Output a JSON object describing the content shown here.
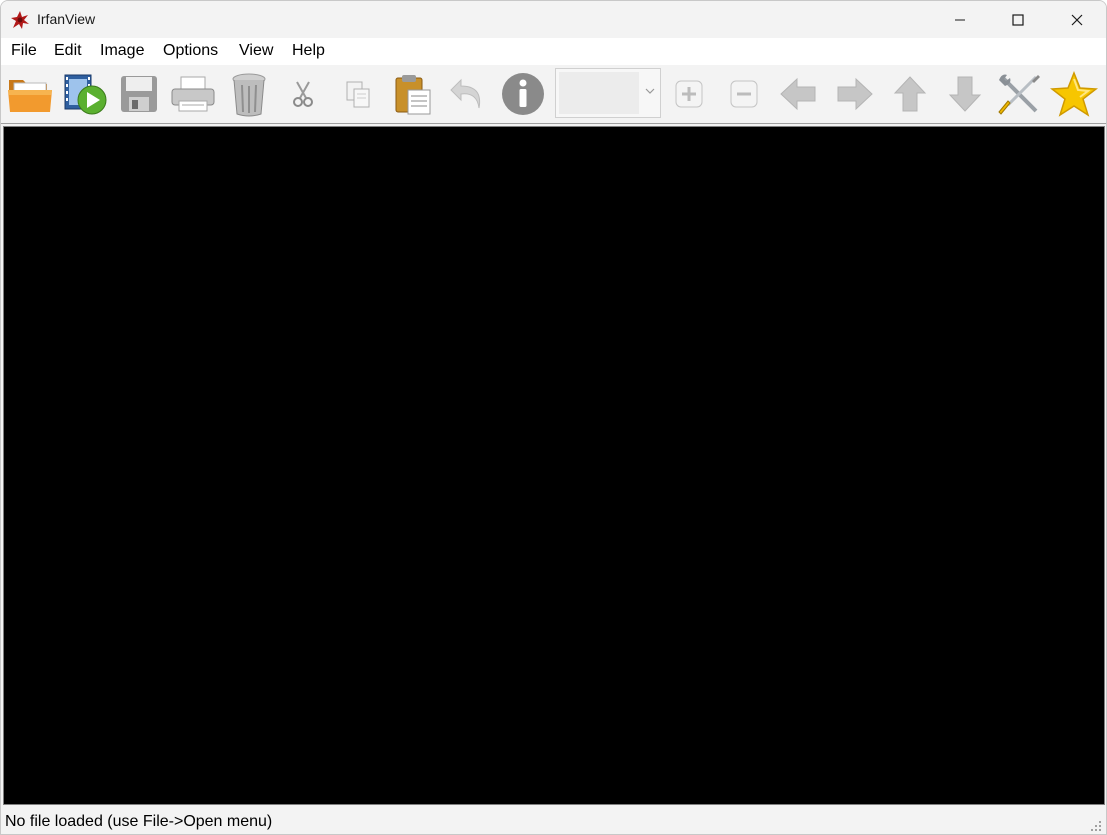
{
  "window": {
    "title": "IrfanView"
  },
  "menu": {
    "items": [
      "File",
      "Edit",
      "Image",
      "Options",
      "View",
      "Help"
    ]
  },
  "toolbar": {
    "buttons": [
      {
        "icon": "folder-open-icon"
      },
      {
        "icon": "slideshow-icon"
      },
      {
        "icon": "save-icon"
      },
      {
        "icon": "print-icon"
      },
      {
        "icon": "trash-icon"
      },
      {
        "icon": "cut-icon"
      },
      {
        "icon": "copy-icon"
      },
      {
        "icon": "paste-icon"
      },
      {
        "icon": "undo-icon"
      },
      {
        "icon": "info-icon"
      },
      {
        "icon": "zoom-in-icon"
      },
      {
        "icon": "zoom-out-icon"
      },
      {
        "icon": "arrow-left-icon"
      },
      {
        "icon": "arrow-right-icon"
      },
      {
        "icon": "arrow-up-icon"
      },
      {
        "icon": "arrow-down-icon"
      },
      {
        "icon": "settings-tools-icon"
      },
      {
        "icon": "star-icon"
      }
    ],
    "zoom_value": ""
  },
  "colors": {
    "canvas_background": "#000000",
    "chrome_background": "#f3f3f3",
    "menu_background": "#ffffff",
    "accent_folder": "#f0a030",
    "accent_star": "#f5c000"
  },
  "status": {
    "text": "No file loaded (use File->Open menu)"
  }
}
